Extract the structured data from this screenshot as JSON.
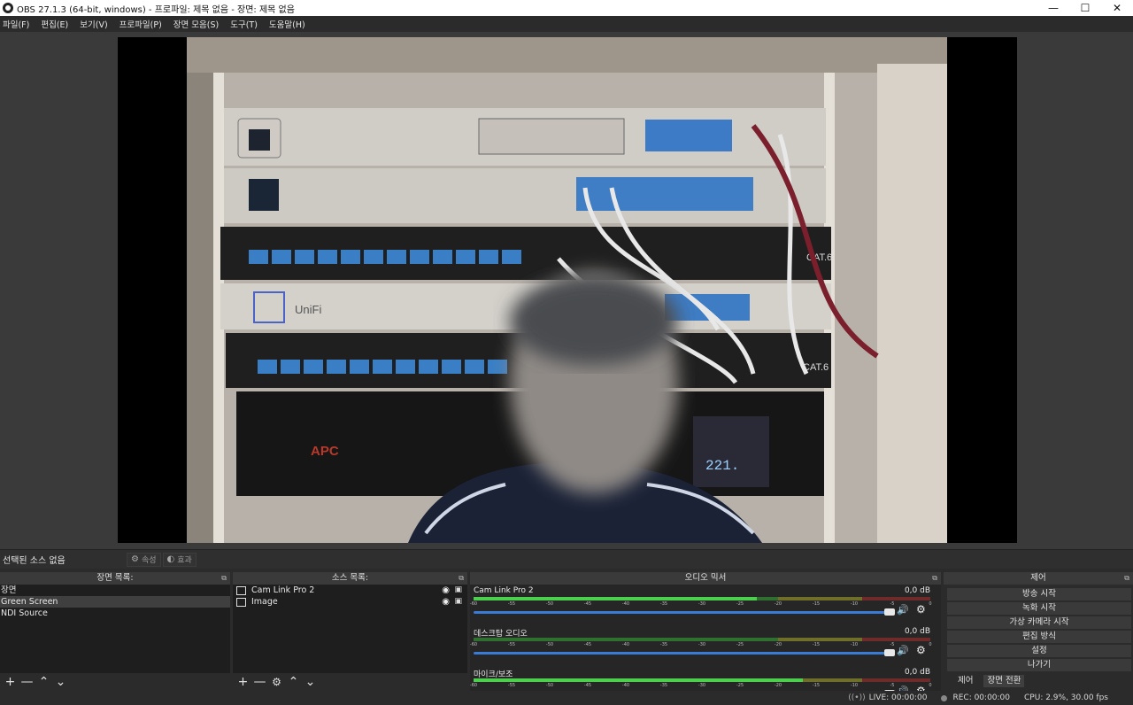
{
  "window": {
    "title": "OBS 27.1.3 (64-bit, windows) - 프로파일: 제목 없음 - 장면: 제목 없음",
    "icon": "obs-logo-icon"
  },
  "menu": [
    "파일(F)",
    "편집(E)",
    "보기(V)",
    "프로파일(P)",
    "장면 모음(S)",
    "도구(T)",
    "도움말(H)"
  ],
  "preview": {
    "description_icon": "server-rack-preview-image",
    "panel_labels": [
      "CAT.6",
      "CAT.6"
    ],
    "ups_brand": "APC",
    "ups_display": "221."
  },
  "source_toolbar": {
    "no_source": "선택된 소스 없음",
    "properties": "속성",
    "filters": "효과"
  },
  "scenes": {
    "header": "장면 목록:",
    "items": [
      "장면",
      "Green Screen",
      "NDI Source"
    ],
    "selected_index": 1
  },
  "sources": {
    "header": "소스 목록:",
    "items": [
      {
        "name": "Cam Link Pro 2",
        "icon": "camera-icon"
      },
      {
        "name": "Image",
        "icon": "image-icon"
      }
    ]
  },
  "mixer": {
    "header": "오디오 믹서",
    "tick_labels": [
      "-60",
      "-55",
      "-50",
      "-45",
      "-40",
      "-35",
      "-30",
      "-25",
      "-20",
      "-15",
      "-10",
      "-5",
      "0"
    ],
    "tracks": [
      {
        "name": "Cam Link Pro 2",
        "db": "0,0 dB",
        "level": 0.62,
        "volume": 1.0
      },
      {
        "name": "데스크탑 오디오",
        "db": "0,0 dB",
        "level": 0.0,
        "volume": 1.0
      },
      {
        "name": "마이크/보조",
        "db": "0,0 dB",
        "level": 0.72,
        "volume": 1.0
      }
    ]
  },
  "controls": {
    "header": "제어",
    "buttons": [
      "방송 시작",
      "녹화 시작",
      "가상 카메라 시작",
      "편집 방식",
      "설정",
      "나가기"
    ],
    "tabs": [
      "제어",
      "장면 전환"
    ],
    "active_tab": 1
  },
  "status": {
    "live": "LIVE: 00:00:00",
    "rec": "REC: 00:00:00",
    "cpu": "CPU: 2.9%, 30.00 fps"
  }
}
